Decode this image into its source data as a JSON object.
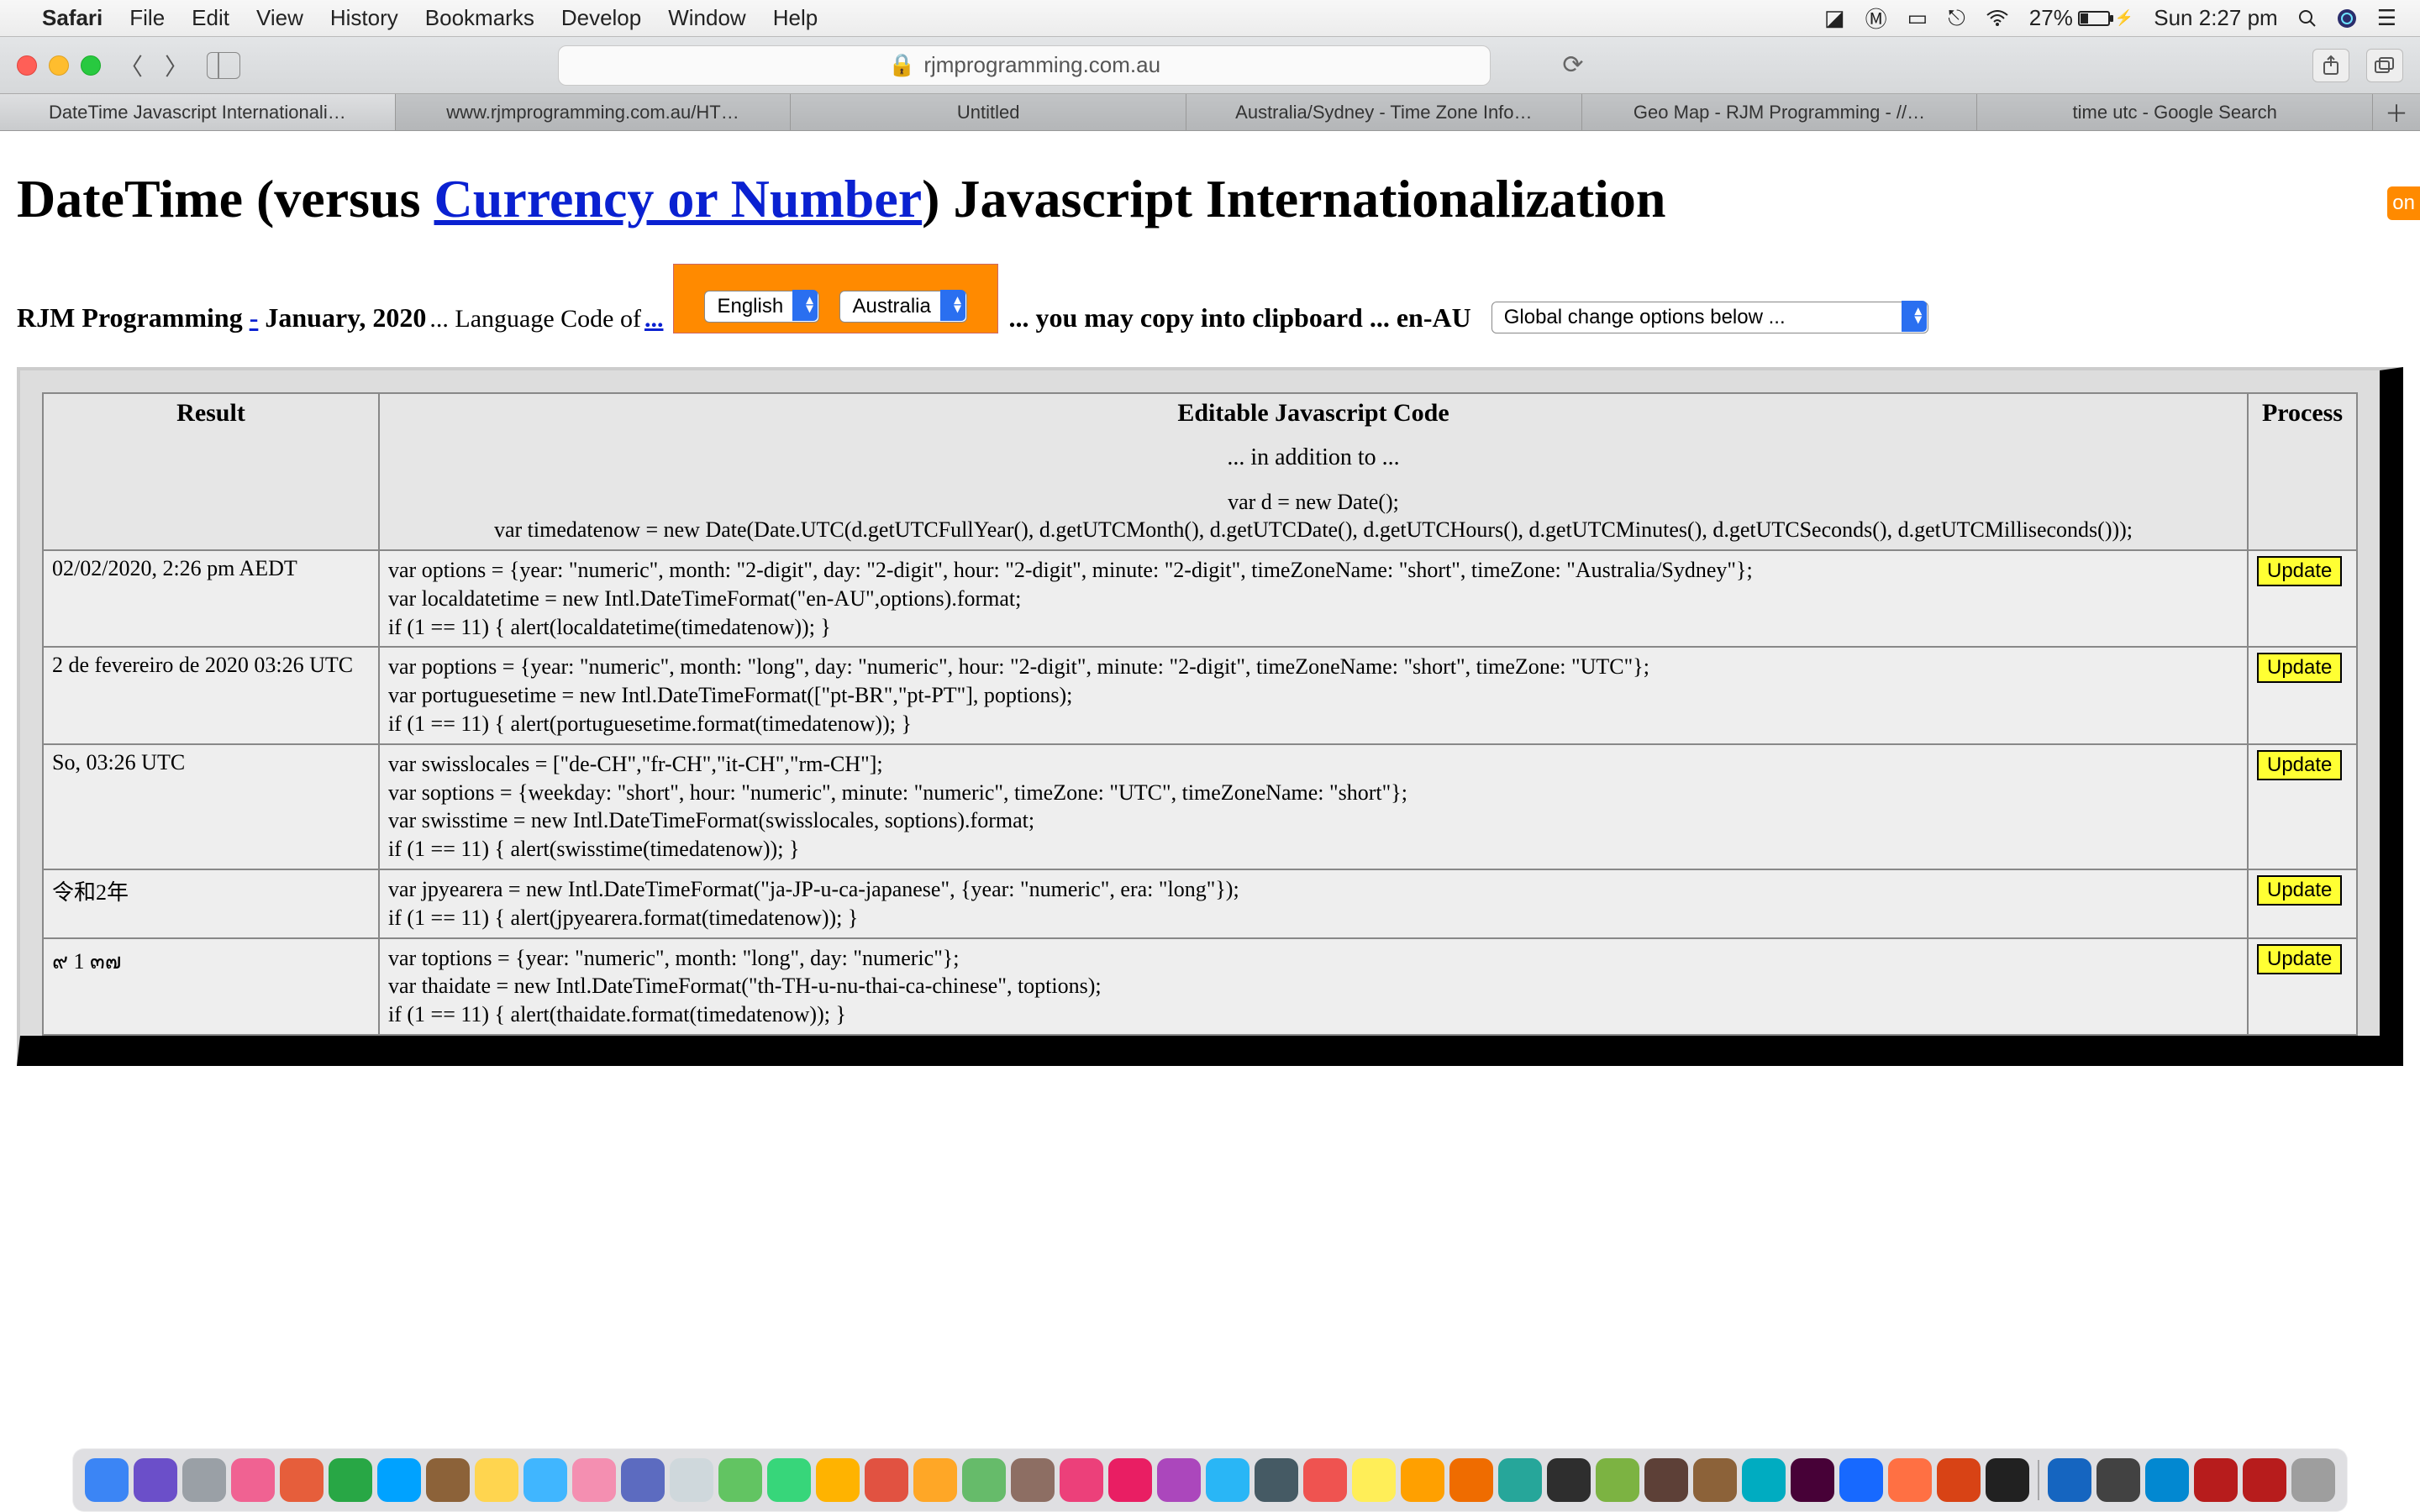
{
  "menubar": {
    "app": "Safari",
    "items": [
      "File",
      "Edit",
      "View",
      "History",
      "Bookmarks",
      "Develop",
      "Window",
      "Help"
    ],
    "battery_pct": "27%",
    "clock": "Sun 2:27 pm"
  },
  "toolbar": {
    "url_host": "rjmprogramming.com.au"
  },
  "tabs": [
    "DateTime Javascript Internationali…",
    "www.rjmprogramming.com.au/HT…",
    "Untitled",
    "Australia/Sydney - Time Zone Info…",
    "Geo Map - RJM Programming - //…",
    "time utc - Google Search"
  ],
  "page": {
    "title_pre": "DateTime (versus ",
    "title_link": "Currency or Number",
    "title_post": ") Javascript Internationalization",
    "byline_pre": "RJM Programming ",
    "byline_dash": "-",
    "byline_post": " January, 2020",
    "langcode_label": " ... Language Code of ",
    "ellipsis": "...",
    "lang_select": "English",
    "country_select": "Australia",
    "copy_lead": "... you may copy into clipboard ... ",
    "locale_code": "en-AU",
    "global_placeholder": "Global change options below ...",
    "edge_badge": "on"
  },
  "table": {
    "head_result": "Result",
    "head_code": "Editable Javascript Code",
    "head_sub": "... in addition to ...",
    "head_process": "Process",
    "head_snippet": "var d = new Date();\nvar timedatenow = new Date(Date.UTC(d.getUTCFullYear(), d.getUTCMonth(), d.getUTCDate(), d.getUTCHours(), d.getUTCMinutes(), d.getUTCSeconds(), d.getUTCMilliseconds()));",
    "update_label": "Update",
    "rows": [
      {
        "result": "02/02/2020, 2:26 pm AEDT",
        "code": "var options = {year: \"numeric\", month: \"2-digit\", day: \"2-digit\", hour: \"2-digit\", minute: \"2-digit\", timeZoneName: \"short\", timeZone: \"Australia/Sydney\"};\nvar localdatetime = new Intl.DateTimeFormat(\"en-AU\",options).format;\nif (1 == 11) { alert(localdatetime(timedatenow)); }"
      },
      {
        "result": "2 de fevereiro de 2020 03:26 UTC",
        "code": "var poptions = {year: \"numeric\", month: \"long\", day: \"numeric\", hour: \"2-digit\", minute: \"2-digit\", timeZoneName: \"short\", timeZone: \"UTC\"};\nvar portuguesetime = new Intl.DateTimeFormat([\"pt-BR\",\"pt-PT\"], poptions);\nif (1 == 11) { alert(portuguesetime.format(timedatenow)); }"
      },
      {
        "result": "So, 03:26 UTC",
        "code": "var swisslocales = [\"de-CH\",\"fr-CH\",\"it-CH\",\"rm-CH\"];\nvar soptions = {weekday: \"short\", hour: \"numeric\", minute: \"numeric\", timeZone: \"UTC\", timeZoneName: \"short\"};\nvar swisstime = new Intl.DateTimeFormat(swisslocales, soptions).format;\nif (1 == 11) { alert(swisstime(timedatenow)); }"
      },
      {
        "result": "令和2年",
        "code": "var jpyearera = new Intl.DateTimeFormat(\"ja-JP-u-ca-japanese\", {year: \"numeric\", era: \"long\"});\nif (1 == 11) { alert(jpyearera.format(timedatenow)); }"
      },
      {
        "result": "๙ 1 ๓๗",
        "code": "var toptions = {year: \"numeric\", month: \"long\", day: \"numeric\"};\nvar thaidate = new Intl.DateTimeFormat(\"th-TH-u-nu-thai-ca-chinese\", toptions);\nif (1 == 11) { alert(thaidate.format(timedatenow)); }"
      }
    ]
  },
  "dock_colors": [
    "#3b85f5",
    "#6b4fc9",
    "#9aa0a6",
    "#f06292",
    "#e65e3b",
    "#28a745",
    "#00a2ff",
    "#8c6239",
    "#ffd54f",
    "#40b6ff",
    "#f48fb1",
    "#5c6bc0",
    "#cfd8dc",
    "#62c462",
    "#37d67a",
    "#ffb300",
    "#e15241",
    "#ffa726",
    "#66bb6a",
    "#8d6e63",
    "#ec407a",
    "#e91e63",
    "#ab47bc",
    "#29b6f6",
    "#455a64",
    "#ef5350",
    "#ffee58",
    "#ffa000",
    "#ef6c00",
    "#26a69a",
    "#2e2e2e",
    "#7cb342",
    "#5d4037",
    "#8c6239",
    "#00acc1",
    "#470137",
    "#1769ff",
    "#ff7043",
    "#d84315",
    "#212121",
    "#1565c0",
    "#424242",
    "#0288d1",
    "#b71c1c",
    "#b71c1c",
    "#9e9e9e"
  ]
}
